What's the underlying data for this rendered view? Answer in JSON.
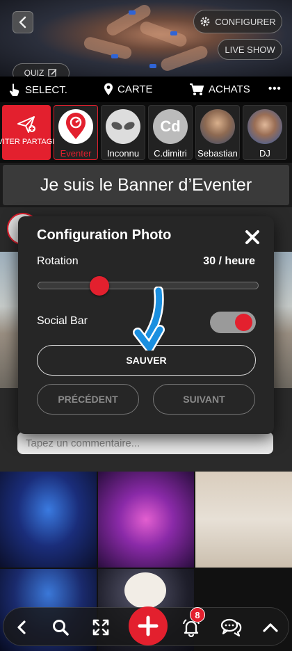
{
  "header": {
    "configurer_label": "CONFIGURER",
    "liveshow_label": "LIVE SHOW",
    "quiz_label": "QUIZ"
  },
  "nav": {
    "select_label": "SELECT.",
    "map_label": "CARTE",
    "purchases_label": "ACHATS",
    "more_label": "•••"
  },
  "stories": {
    "invite_label": "INVITER PARTAGER",
    "items": [
      {
        "label": "Eventer",
        "active": true
      },
      {
        "label": "Inconnu"
      },
      {
        "label": "C.dimitri",
        "initials": "Cd"
      },
      {
        "label": "Sebastian"
      },
      {
        "label": "DJ"
      }
    ]
  },
  "banner": {
    "text": "Je suis le Banner d’Eventer"
  },
  "feed": {
    "comment_placeholder": "Tapez un commentaire..."
  },
  "modal": {
    "title": "Configuration Photo",
    "rotation_label": "Rotation",
    "rotation_value": "30 / heure",
    "rotation_slider_fraction": 0.28,
    "social_bar_label": "Social Bar",
    "social_bar_on": true,
    "save_label": "SAUVER",
    "prev_label": "PRÉCÉDENT",
    "next_label": "SUIVANT"
  },
  "toolbar": {
    "notifications_count": "8"
  },
  "colors": {
    "accent": "#e3202e",
    "arrow": "#1a8fe0"
  }
}
